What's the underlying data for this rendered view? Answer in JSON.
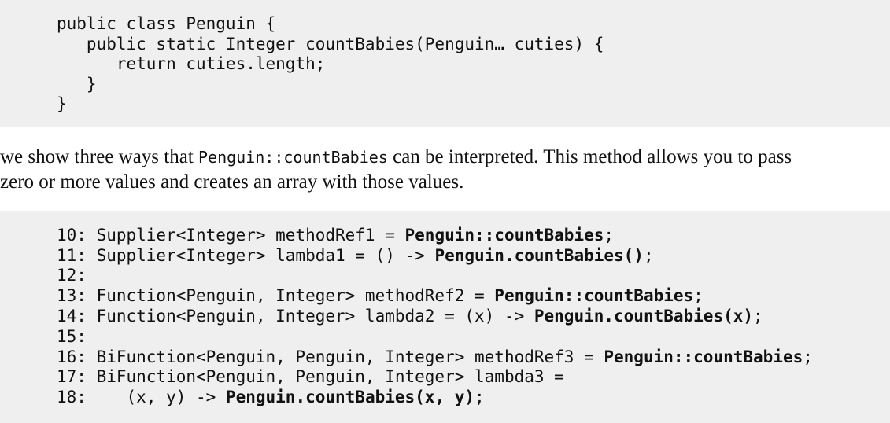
{
  "code_block_1": {
    "lines": [
      "public class Penguin {",
      "   public static Integer countBabies(Penguin… cuties) {",
      "      return cuties.length;",
      "   }",
      "}"
    ]
  },
  "paragraph": {
    "text_before": "we show three ways that ",
    "inline_code": "Penguin::countBabies",
    "text_after_line1": " can be interpreted. This method allows you to pass",
    "text_line2": "zero or more values and creates an array with those values."
  },
  "code_block_2": {
    "lines": [
      {
        "prefix": "10: Supplier<Integer> methodRef1 = ",
        "bold": "Penguin::countBabies",
        "suffix": ";"
      },
      {
        "prefix": "11: Supplier<Integer> lambda1 = () -> ",
        "bold": "Penguin.countBabies()",
        "suffix": ";"
      },
      {
        "prefix": "12:",
        "bold": "",
        "suffix": ""
      },
      {
        "prefix": "13: Function<Penguin, Integer> methodRef2 = ",
        "bold": "Penguin::countBabies",
        "suffix": ";"
      },
      {
        "prefix": "14: Function<Penguin, Integer> lambda2 = (x) -> ",
        "bold": "Penguin.countBabies(x)",
        "suffix": ";"
      },
      {
        "prefix": "15:",
        "bold": "",
        "suffix": ""
      },
      {
        "prefix": "16: BiFunction<Penguin, Penguin, Integer> methodRef3 = ",
        "bold": "Penguin::countBabies",
        "suffix": ";"
      },
      {
        "prefix": "17: BiFunction<Penguin, Penguin, Integer> lambda3 =",
        "bold": "",
        "suffix": ""
      },
      {
        "prefix": "18:    (x, y) -> ",
        "bold": "Penguin.countBabies(x, y)",
        "suffix": ";"
      }
    ]
  }
}
